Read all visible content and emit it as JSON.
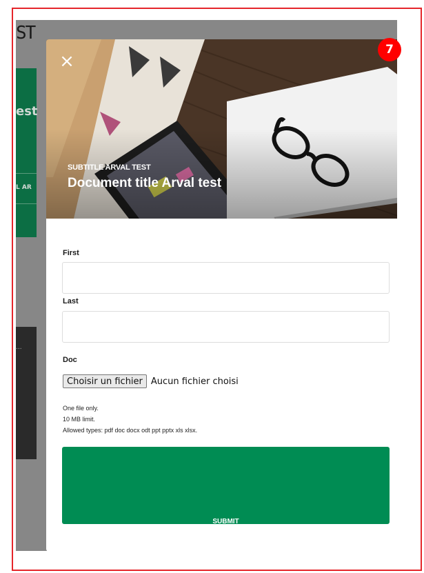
{
  "background": {
    "logo_text": "ST",
    "green_text": "est",
    "green_subtext": "L AR",
    "dark_text": "...",
    "right_mark": "?"
  },
  "badge": {
    "count": "7"
  },
  "modal": {
    "close_icon": "×",
    "subtitle": "SUBTITLE ARVAL TEST",
    "title": "Document title Arval test"
  },
  "form": {
    "first": {
      "label": "First",
      "value": "",
      "placeholder": ""
    },
    "last": {
      "label": "Last",
      "value": "",
      "placeholder": ""
    },
    "doc": {
      "label": "Doc",
      "button_label": "Choisir un fichier",
      "status": "Aucun fichier choisi",
      "help": [
        "One file only.",
        "10 MB limit.",
        "Allowed types: pdf doc docx odt ppt pptx xls xlsx."
      ]
    },
    "submit_label": "SUBMIT"
  },
  "colors": {
    "accent": "#008c53",
    "frame": "#e5252a",
    "badge": "#ff0000",
    "overlay": "#878787"
  }
}
